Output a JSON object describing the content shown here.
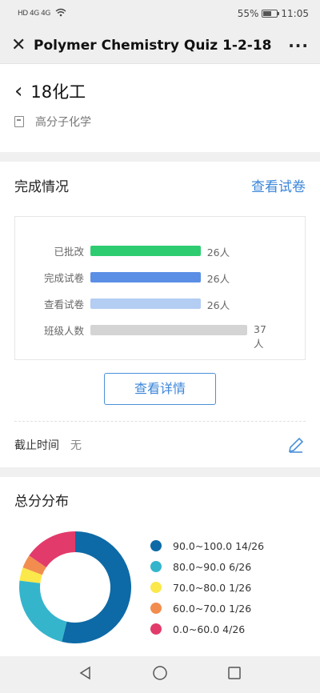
{
  "status": {
    "signal": "HD 4G 4G",
    "battery": "55%",
    "battery_level": 0.55,
    "time": "11:05"
  },
  "titlebar": {
    "title": "Polymer Chemistry Quiz 1-2-18"
  },
  "course": {
    "class_name": "18化工",
    "subject": "高分子化学"
  },
  "completion": {
    "title": "完成情况",
    "view_paper_link": "查看试卷",
    "bars": [
      {
        "label": "已批改",
        "count": 26,
        "value_text": "26人",
        "color": "#2ecc71"
      },
      {
        "label": "完成试卷",
        "count": 26,
        "value_text": "26人",
        "color": "#5b8fe6"
      },
      {
        "label": "查看试卷",
        "count": 26,
        "value_text": "26人",
        "color": "#b3cdf3"
      },
      {
        "label": "班级人数",
        "count": 37,
        "value_text": "37人",
        "color": "#d4d4d4"
      }
    ],
    "bar_max": 37,
    "detail_button": "查看详情",
    "deadline_label": "截止时间",
    "deadline_value": "无"
  },
  "distribution": {
    "title": "总分分布",
    "chart_data": {
      "type": "pie",
      "categories": [
        "90.0~100.0",
        "80.0~90.0",
        "70.0~80.0",
        "60.0~70.0",
        "0.0~60.0"
      ],
      "values": [
        14,
        6,
        1,
        1,
        4
      ],
      "total": 26,
      "labels": [
        "90.0~100.0 14/26",
        "80.0~90.0 6/26",
        "70.0~80.0 1/26",
        "60.0~70.0 1/26",
        "0.0~60.0 4/26"
      ],
      "colors": [
        "#0d6aa6",
        "#35b5cc",
        "#fbe84a",
        "#f28d4f",
        "#e23b6b"
      ]
    }
  }
}
